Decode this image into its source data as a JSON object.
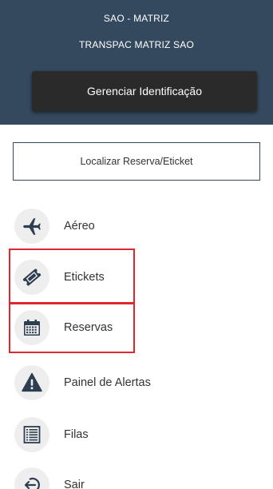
{
  "header": {
    "line1": "SAO - MATRIZ",
    "line2": "TRANSPAC MATRIZ SAO",
    "manage_button": "Gerenciar Identificação"
  },
  "search": {
    "label": "Localizar Reserva/Eticket"
  },
  "menu": {
    "items": [
      {
        "label": "Aéreo",
        "icon": "airplane-icon"
      },
      {
        "label": "Etickets",
        "icon": "ticket-icon"
      },
      {
        "label": "Reservas",
        "icon": "calendar-icon"
      },
      {
        "label": "Painel de Alertas",
        "icon": "warning-icon"
      },
      {
        "label": "Filas",
        "icon": "list-icon"
      },
      {
        "label": "Sair",
        "icon": "logout-icon"
      }
    ]
  },
  "colors": {
    "header_bg": "#34495e",
    "button_bg": "#2a2a2a",
    "icon_color": "#2c3e50",
    "highlight": "#e0262e"
  }
}
